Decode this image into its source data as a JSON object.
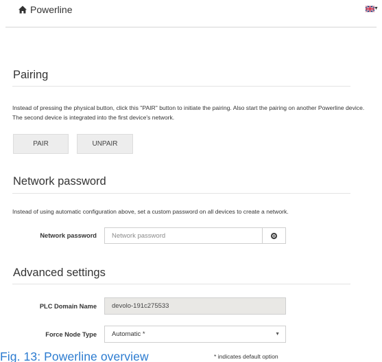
{
  "header": {
    "title": "Powerline",
    "home_icon": "home-icon",
    "language_icon": "uk-flag-icon"
  },
  "pairing": {
    "title": "Pairing",
    "description": "Instead of pressing the physical button, click this \"PAIR\" button to initiate the pairing. Also start the pairing on another Powerline device. The second device is integrated into the first device's network.",
    "pair_label": "PAIR",
    "unpair_label": "UNPAIR"
  },
  "network_password": {
    "title": "Network password",
    "description": "Instead of using automatic configuration above, set a custom password on all devices to create a network.",
    "field_label": "Network password",
    "placeholder": "Network password",
    "value": "",
    "reveal_icon": "eye-icon"
  },
  "advanced": {
    "title": "Advanced settings",
    "domain_label": "PLC Domain Name",
    "domain_value": "devolo-191c275533",
    "force_label": "Force Node Type",
    "force_selected": "Automatic *"
  },
  "footer": {
    "caption": "Fig. 13: Powerline overview",
    "note": "* indicates default option"
  },
  "colors": {
    "caption": "#2b7bd0",
    "readonly_bg": "#e9e8e5",
    "button_bg": "#ededed"
  }
}
